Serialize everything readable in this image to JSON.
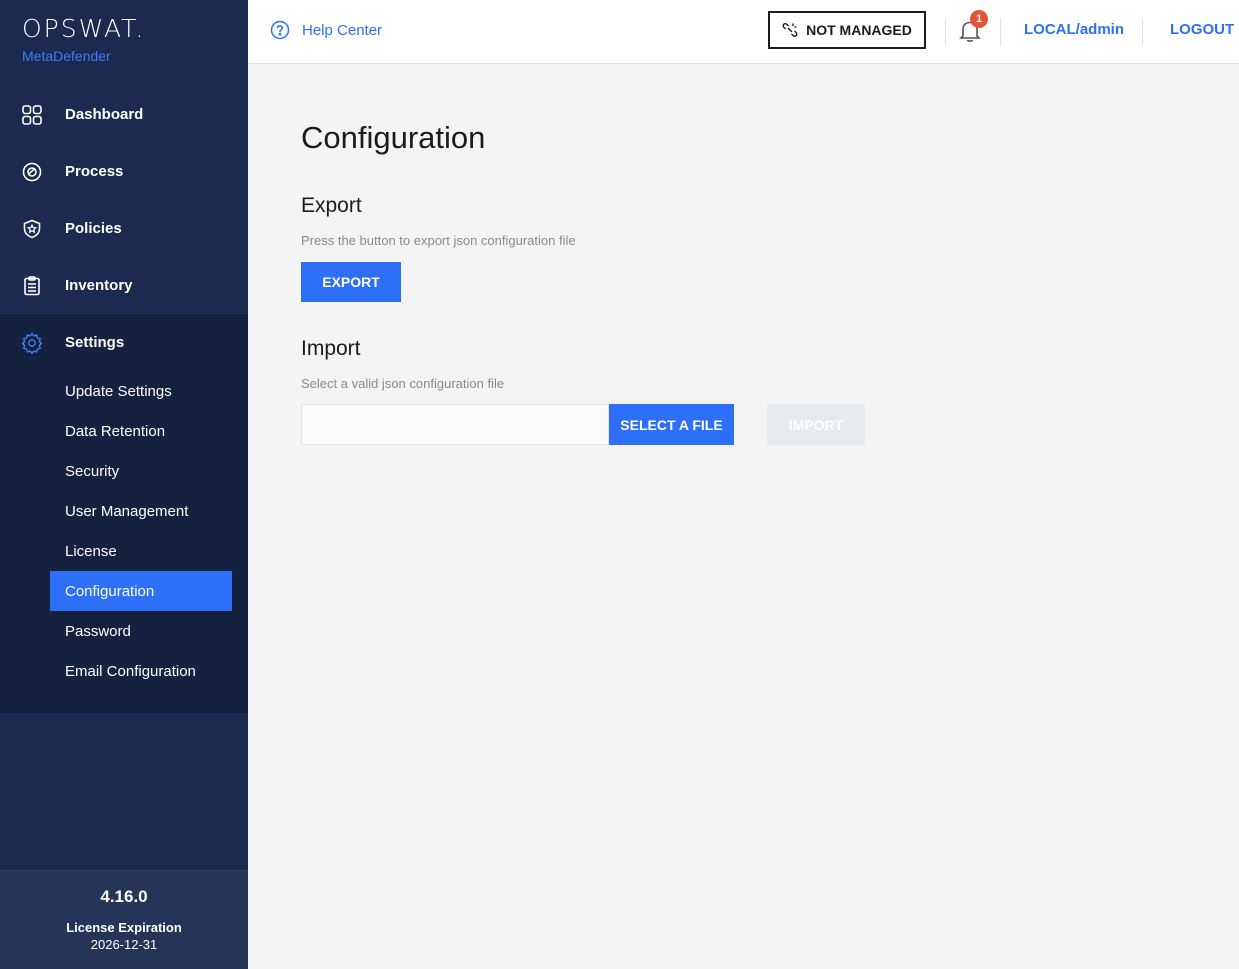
{
  "brand": {
    "logo": "OPSWAT.",
    "product": "MetaDefender"
  },
  "nav": [
    {
      "label": "Dashboard",
      "icon": "dashboard-icon"
    },
    {
      "label": "Process",
      "icon": "process-icon"
    },
    {
      "label": "Policies",
      "icon": "policies-icon"
    },
    {
      "label": "Inventory",
      "icon": "inventory-icon"
    }
  ],
  "settings": {
    "label": "Settings",
    "icon": "gear-icon",
    "items": [
      {
        "label": "Update Settings",
        "active": false
      },
      {
        "label": "Data Retention",
        "active": false
      },
      {
        "label": "Security",
        "active": false
      },
      {
        "label": "User Management",
        "active": false
      },
      {
        "label": "License",
        "active": false
      },
      {
        "label": "Configuration",
        "active": true
      },
      {
        "label": "Password",
        "active": false
      },
      {
        "label": "Email Configuration",
        "active": false
      }
    ]
  },
  "footer": {
    "version": "4.16.0",
    "license_label": "License Expiration",
    "license_date": "2026-12-31"
  },
  "topbar": {
    "help": "Help Center",
    "managed_status": "NOT MANAGED",
    "notification_count": "1",
    "user": "LOCAL/admin",
    "logout": "LOGOUT"
  },
  "page": {
    "title": "Configuration",
    "export": {
      "title": "Export",
      "hint": "Press the button to export json configuration file",
      "button": "EXPORT"
    },
    "import": {
      "title": "Import",
      "hint": "Select a valid json configuration file",
      "file_value": "",
      "select_button": "SELECT A FILE",
      "import_button": "IMPORT"
    }
  },
  "colors": {
    "sidebar": "#1b2a4e",
    "accent": "#2d6ff6",
    "badge": "#e35336"
  }
}
